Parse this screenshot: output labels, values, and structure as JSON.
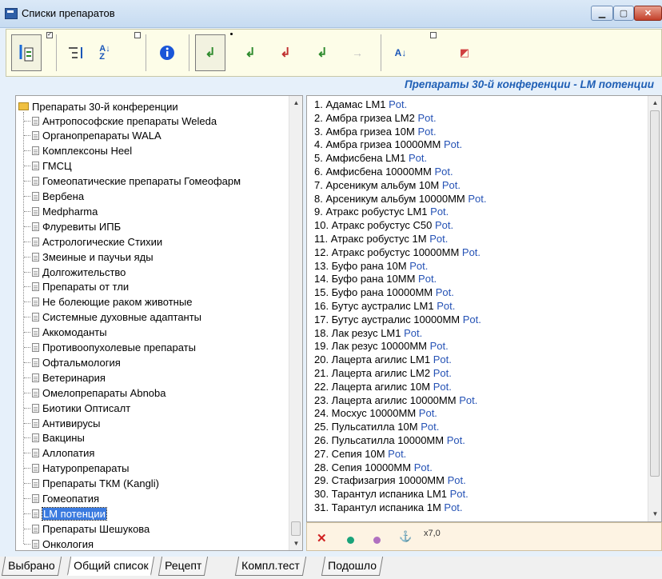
{
  "window": {
    "title": "Списки препаратов"
  },
  "header": {
    "title": "Препараты 30-й конференции - LM потенции"
  },
  "tree": {
    "root": "Препараты 30-й конференции",
    "items": [
      "Антропософские препараты Weleda",
      "Органопрепараты WALA",
      "Комплексоны Heel",
      "ГМСЦ",
      "Гомеопатические препараты Гомеофарм",
      "Вербена",
      "Medpharma",
      "Флуревиты ИПБ",
      "Астрологические Стихии",
      "Змеиные и паучьи яды",
      "Долгожительство",
      "Препараты от тли",
      "Не болеющие раком животные",
      "Системные духовные адаптанты",
      "Аккомоданты",
      "Противоопухолевые препараты",
      "Офтальмология",
      "Ветеринария",
      "Омелопрепараты Abnoba",
      "Биотики Оптисалт",
      "Антивирусы",
      "Вакцины",
      "Аллопатия",
      "Натуропрепараты",
      "Препараты ТКМ (Kangli)",
      "Гомеопатия",
      "LM потенции",
      "Препараты Шешукова",
      "Онкология"
    ],
    "selected_index": 26
  },
  "list": {
    "suffix": "Pot.",
    "items": [
      "1. Адамас LM1",
      "2. Амбра гризеа LM2",
      "3. Амбра гризеа 10M",
      "4. Амбра гризеа 10000MM",
      "5. Амфисбена LM1",
      "6. Амфисбена 10000MM",
      "7. Арсеникум альбум 10M",
      "8. Арсеникум альбум 10000MM",
      "9. Атракс робустус LM1",
      "10. Атракс робустус C50",
      "11. Атракс робустус 1M",
      "12. Атракс робустус 10000MM",
      "13. Буфо рана 10M",
      "14. Буфо рана 10MM",
      "15. Буфо рана 10000MM",
      "16. Бутус аустралис LM1",
      "17. Бутус аустралис 10000MM",
      "18. Лак резус LM1",
      "19. Лак резус 10000MM",
      "20. Лацерта агилис LM1",
      "21. Лацерта агилис LM2",
      "22. Лацерта агилис 10M",
      "23. Лацерта агилис 10000MM",
      "24. Мосхус 10000MM",
      "25. Пульсатилла 10M",
      "26. Пульсатилла 10000MM",
      "27. Сепия 10M",
      "28. Сепия 10000MM",
      "29. Стафизагрия 10000MM",
      "30. Тарантул испаника LM1",
      "31. Тарантул испаника 1M"
    ]
  },
  "status": {
    "zoom": "x7,0"
  },
  "tabs": [
    "Выбрано",
    "Общий список",
    "Рецепт",
    "Компл.тест",
    "Подошло"
  ],
  "active_tab": 1,
  "toolbar_icons": [
    "eyedropper-icon",
    "indent-list-icon",
    "sort-az-icon",
    "info-icon",
    "check-arrow-icon",
    "rp-arrow-icon",
    "cross-arrow-icon",
    "exclaim-arrow-icon",
    "arrow-right-icon",
    "sort-az-down-icon",
    "export-icon"
  ],
  "colors": {
    "accent": "#1f5fb5",
    "pot": "#2552b5",
    "selected": "#3b7be0"
  }
}
